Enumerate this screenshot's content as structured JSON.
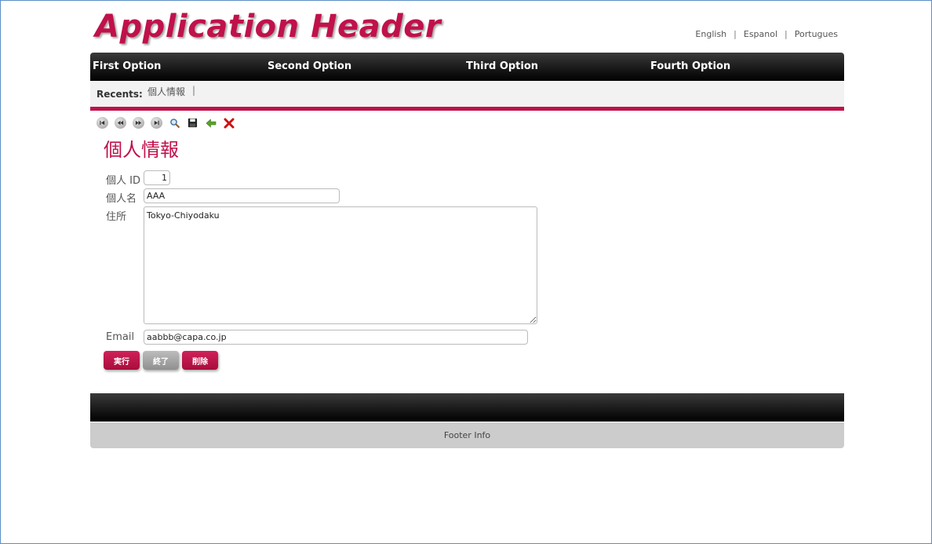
{
  "header": {
    "title": "Application Header"
  },
  "languages": [
    "English",
    "Espanol",
    "Portugues"
  ],
  "language_separator": "|",
  "nav": [
    "First Option",
    "Second Option",
    "Third Option",
    "Fourth Option"
  ],
  "recents": {
    "label": "Recents:",
    "items": [
      "個人情報"
    ],
    "separator": "|"
  },
  "toolbar": {
    "icons": [
      "first-record-icon",
      "previous-record-icon",
      "next-record-icon",
      "last-record-icon",
      "search-icon",
      "save-icon",
      "back-arrow-icon",
      "delete-x-icon"
    ],
    "colors": {
      "arrow": "#5aa02c",
      "delete": "#cc1111"
    }
  },
  "page": {
    "title": "個人情報"
  },
  "form": {
    "id_label": "個人 ID",
    "id_value": "1",
    "name_label": "個人名",
    "name_value": "AAA",
    "address_label": "住所",
    "address_value": "Tokyo-Chiyodaku",
    "email_label": "Email",
    "email_value": "aabbb@capa.co.jp"
  },
  "buttons": {
    "execute": "実行",
    "close": "終了",
    "delete": "削除"
  },
  "footer": {
    "info": "Footer Info"
  },
  "colors": {
    "accent": "#c0114a",
    "nav_bg": "#000000",
    "footer_info_bg": "#cccccc"
  }
}
